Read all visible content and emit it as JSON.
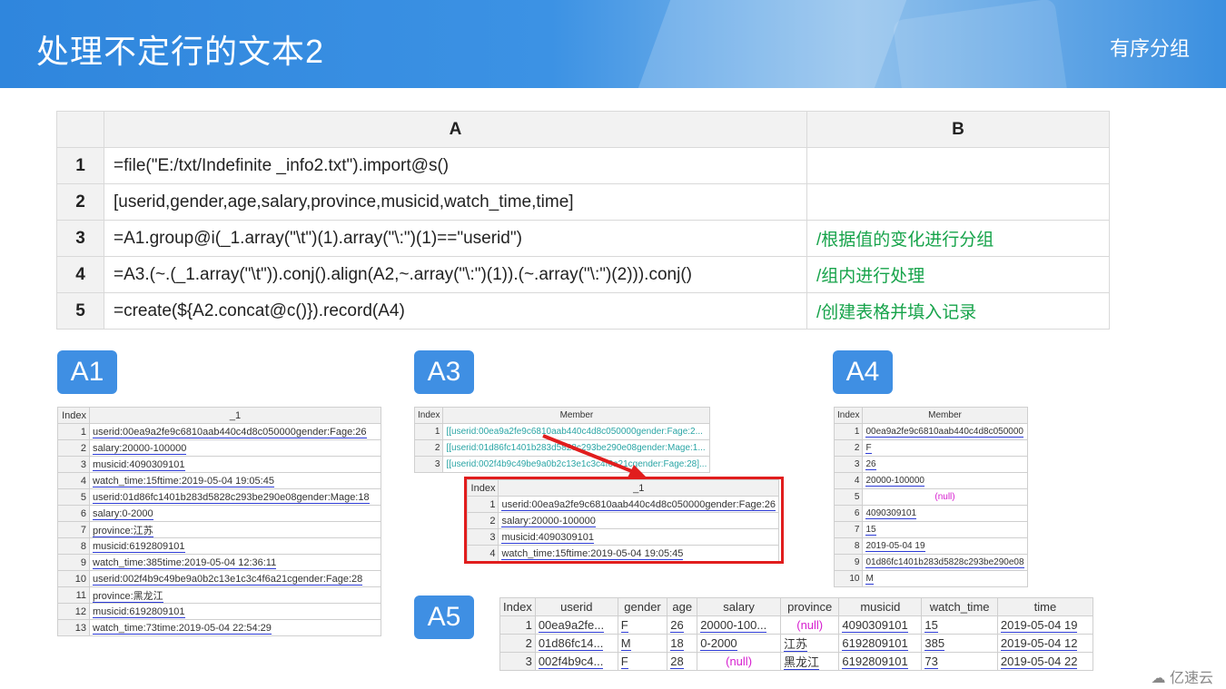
{
  "header": {
    "title": "处理不定行的文本2",
    "subtitle": "有序分组"
  },
  "grid": {
    "col_a": "A",
    "col_b": "B",
    "rows": [
      {
        "n": "1",
        "a": "=file(\"E:/txt/Indefinite  _info2.txt\").import@s()",
        "b": ""
      },
      {
        "n": "2",
        "a": "[userid,gender,age,salary,province,musicid,watch_time,time]",
        "b": ""
      },
      {
        "n": "3",
        "a": "=A1.group@i(_1.array(\"\\t\")(1).array(\"\\:\")(1)==\"userid\")",
        "b": "/根据值的变化进行分组"
      },
      {
        "n": "4",
        "a": "=A3.(~.(_1.array(\"\\t\")).conj().align(A2,~.array(\"\\:\")(1)).(~.array(\"\\:\")(2))).conj()",
        "b": "/组内进行处理"
      },
      {
        "n": "5",
        "a": "=create(${A2.concat@c()}).record(A4)",
        "b": "/创建表格并填入记录"
      }
    ]
  },
  "badges": {
    "a1": "A1",
    "a3": "A3",
    "a4": "A4",
    "a5": "A5"
  },
  "a1": {
    "h_index": "Index",
    "h_col": "_1",
    "rows": [
      [
        "1",
        "userid:00ea9a2fe9c6810aab440c4d8c050000gender:Fage:26"
      ],
      [
        "2",
        "salary:20000-100000"
      ],
      [
        "3",
        "musicid:4090309101"
      ],
      [
        "4",
        "watch_time:15ftime:2019-05-04 19:05:45"
      ],
      [
        "5",
        "userid:01d86fc1401b283d5828c293be290e08gender:Mage:18"
      ],
      [
        "6",
        "salary:0-2000"
      ],
      [
        "7",
        "province:江苏"
      ],
      [
        "8",
        "musicid:6192809101"
      ],
      [
        "9",
        "watch_time:385time:2019-05-04 12:36:11"
      ],
      [
        "10",
        "userid:002f4b9c49be9a0b2c13e1c3c4f6a21cgender:Fage:28"
      ],
      [
        "11",
        "province:黑龙江"
      ],
      [
        "12",
        "musicid:6192809101"
      ],
      [
        "13",
        "watch_time:73time:2019-05-04 22:54:29"
      ]
    ]
  },
  "a3": {
    "h_index": "Index",
    "h_col": "Member",
    "rows": [
      [
        "1",
        "[[userid:00ea9a2fe9c6810aab440c4d8c050000gender:Fage:2..."
      ],
      [
        "2",
        "[[userid:01d86fc1401b283d5828c293be290e08gender:Mage:1..."
      ],
      [
        "3",
        "[[userid:002f4b9c49be9a0b2c13e1c3c4f6a21cgender:Fage:28]..."
      ]
    ]
  },
  "a3_detail": {
    "h_index": "Index",
    "h_col": "_1",
    "rows": [
      [
        "1",
        "userid:00ea9a2fe9c6810aab440c4d8c050000gender:Fage:26"
      ],
      [
        "2",
        "salary:20000-100000"
      ],
      [
        "3",
        "musicid:4090309101"
      ],
      [
        "4",
        "watch_time:15ftime:2019-05-04 19:05:45"
      ]
    ]
  },
  "a4": {
    "h_index": "Index",
    "h_col": "Member",
    "rows": [
      [
        "1",
        "00ea9a2fe9c6810aab440c4d8c050000"
      ],
      [
        "2",
        "F"
      ],
      [
        "3",
        "26"
      ],
      [
        "4",
        "20000-100000"
      ],
      [
        "5",
        "(null)"
      ],
      [
        "6",
        "4090309101"
      ],
      [
        "7",
        "15"
      ],
      [
        "8",
        "2019-05-04 19"
      ],
      [
        "9",
        "01d86fc1401b283d5828c293be290e08"
      ],
      [
        "10",
        "M"
      ]
    ]
  },
  "a5": {
    "headers": [
      "Index",
      "userid",
      "gender",
      "age",
      "salary",
      "province",
      "musicid",
      "watch_time",
      "time"
    ],
    "rows": [
      [
        "1",
        "00ea9a2fe...",
        "F",
        "26",
        "20000-100...",
        "(null)",
        "4090309101",
        "15",
        "2019-05-04 19"
      ],
      [
        "2",
        "01d86fc14...",
        "M",
        "18",
        "0-2000",
        "江苏",
        "6192809101",
        "385",
        "2019-05-04 12"
      ],
      [
        "3",
        "002f4b9c4...",
        "F",
        "28",
        "(null)",
        "黑龙江",
        "6192809101",
        "73",
        "2019-05-04 22"
      ]
    ]
  },
  "watermark": "亿速云",
  "colors": {
    "header_blue": "#2f86dd",
    "badge_blue": "#3f8fe3",
    "comment_green": "#16a34a",
    "highlight_red": "#e11d1d",
    "null_magenta": "#d61ecf"
  }
}
